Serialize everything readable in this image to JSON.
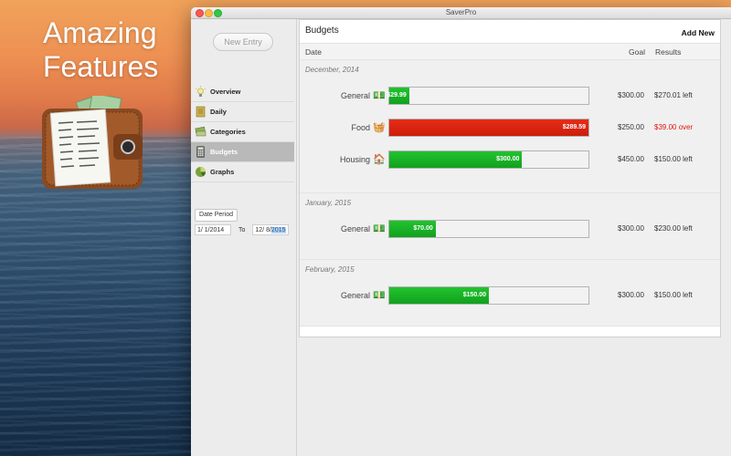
{
  "promo": {
    "line1": "Amazing",
    "line2": "Features"
  },
  "window": {
    "title": "SaverPro"
  },
  "sidebar": {
    "new_entry_label": "New Entry",
    "items": [
      {
        "label": "Overview",
        "icon": "lightbulb-icon"
      },
      {
        "label": "Daily",
        "icon": "notebook-icon"
      },
      {
        "label": "Categories",
        "icon": "tags-icon"
      },
      {
        "label": "Budgets",
        "icon": "calculator-icon",
        "active": true
      },
      {
        "label": "Graphs",
        "icon": "pie-chart-icon"
      }
    ],
    "date_period_label": "Date Period",
    "date_from": "1/  1/2014",
    "date_to_label": "To",
    "date_to_prefix": "12/  8/",
    "date_to_year": "2015"
  },
  "main": {
    "title": "Budgets",
    "add_new_label": "Add New",
    "columns": {
      "date": "Date",
      "goal": "Goal",
      "results": "Results"
    },
    "sections": [
      {
        "title": "December, 2014",
        "rows": [
          {
            "category": "General",
            "icon": "money-icon",
            "value": "$29.99",
            "fill": 0.1,
            "goal": "$300.00",
            "result": "$270.01 left",
            "over": false
          },
          {
            "category": "Food",
            "icon": "basket-icon",
            "value": "$289.59",
            "fill": 1.0,
            "goal": "$250.00",
            "result": "$39.00 over",
            "over": true
          },
          {
            "category": "Housing",
            "icon": "house-icon",
            "value": "$300.00",
            "fill": 0.667,
            "goal": "$450.00",
            "result": "$150.00 left",
            "over": false
          }
        ]
      },
      {
        "title": "January, 2015",
        "rows": [
          {
            "category": "General",
            "icon": "money-icon",
            "value": "$70.00",
            "fill": 0.233,
            "goal": "$300.00",
            "result": "$230.00 left",
            "over": false
          }
        ]
      },
      {
        "title": "February, 2015",
        "rows": [
          {
            "category": "General",
            "icon": "money-icon",
            "value": "$150.00",
            "fill": 0.5,
            "goal": "$300.00",
            "result": "$150.00 left",
            "over": false
          }
        ]
      }
    ]
  },
  "colors": {
    "under": "#17b324",
    "over": "#d9220e",
    "over_text": "#e0180b"
  }
}
